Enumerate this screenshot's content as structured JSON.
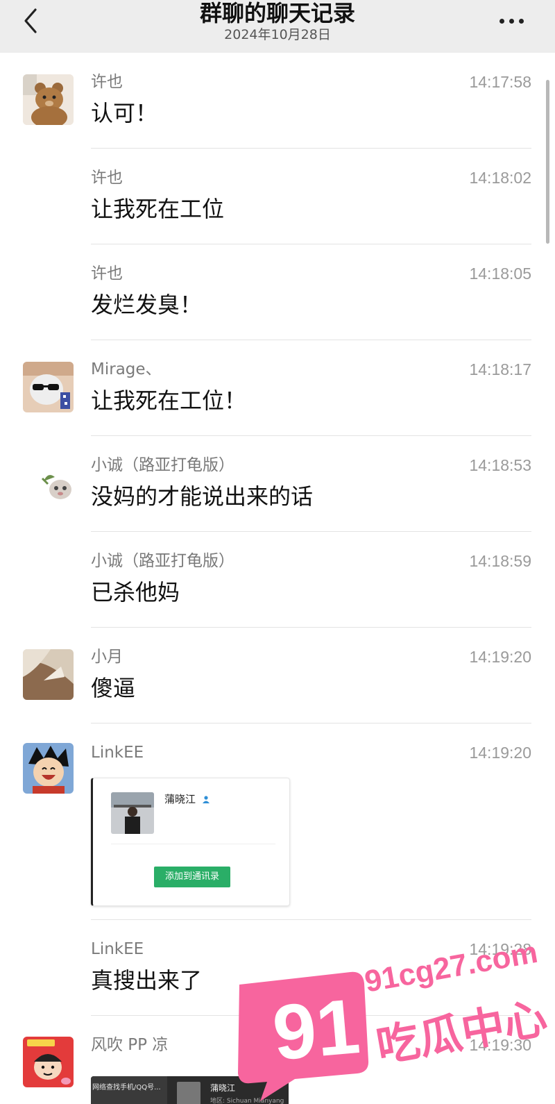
{
  "header": {
    "title": "群聊的聊天记录",
    "date": "2024年10月28日"
  },
  "messages": [
    {
      "sender": "许也",
      "time": "14:17:58",
      "text": "认可！"
    },
    {
      "sender": "许也",
      "time": "14:18:02",
      "text": "让我死在工位"
    },
    {
      "sender": "许也",
      "time": "14:18:05",
      "text": "发烂发臭！"
    },
    {
      "sender": "Mirage、",
      "time": "14:18:17",
      "text": "让我死在工位！"
    },
    {
      "sender": "小诚（路亚打龟版）",
      "time": "14:18:53",
      "text": "没妈的才能说出来的话"
    },
    {
      "sender": "小诚（路亚打龟版）",
      "time": "14:18:59",
      "text": "已杀他妈"
    },
    {
      "sender": "小月",
      "time": "14:19:20",
      "text": "傻逼"
    },
    {
      "sender": "LinkEE",
      "time": "14:19:20",
      "card": {
        "name": "蒲晓江",
        "add_button": "添加到通讯录"
      }
    },
    {
      "sender": "LinkEE",
      "time": "14:19:28",
      "text": "真搜出来了"
    },
    {
      "sender": "风吹 PP 凉",
      "time": "14:19:30",
      "card": {
        "left_text": "网络查找手机/QQ号...",
        "name": "蒲晓江",
        "sub": "地区: Sichuan Mianyang"
      }
    }
  ],
  "watermark": {
    "number": "91",
    "site": "91cg27.com",
    "name": "吃瓜中心",
    "color": "#f7659e"
  },
  "icons": {
    "back": "chevron-left-icon",
    "more": "more-dots-icon"
  }
}
